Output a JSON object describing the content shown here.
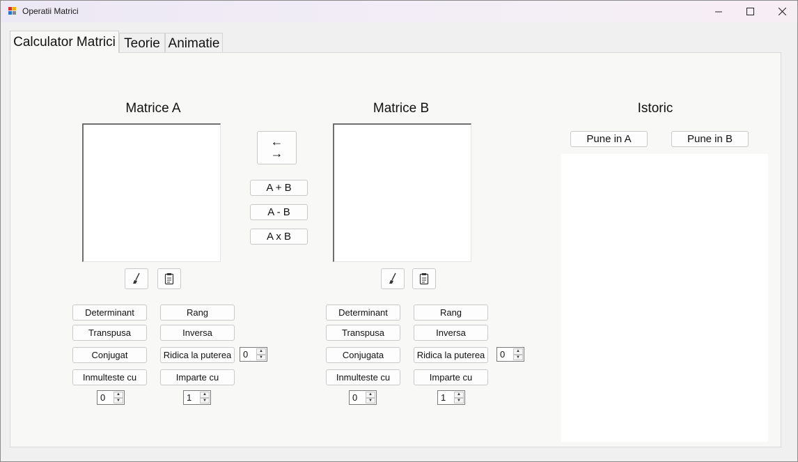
{
  "window": {
    "title": "Operatii Matrici",
    "controls": {
      "minimize": "minimize-icon",
      "maximize": "maximize-icon",
      "close": "close-icon"
    }
  },
  "tabs": [
    {
      "label": "Calculator Matrici",
      "active": true
    },
    {
      "label": "Teorie",
      "active": false
    },
    {
      "label": "Animatie",
      "active": false
    }
  ],
  "matrix_a": {
    "title": "Matrice A",
    "clear_icon": "brush-icon",
    "paste_icon": "clipboard-icon",
    "buttons": {
      "determinant": "Determinant",
      "rang": "Rang",
      "transpusa": "Transpusa",
      "inversa": "Inversa",
      "conjugat": "Conjugat",
      "ridica": "Ridica la puterea",
      "inmulteste": "Inmulteste cu",
      "imparte": "Imparte cu"
    },
    "power_value": "0",
    "multiply_value": "0",
    "divide_value": "1"
  },
  "matrix_b": {
    "title": "Matrice B",
    "clear_icon": "brush-icon",
    "paste_icon": "clipboard-icon",
    "buttons": {
      "determinant": "Determinant",
      "rang": "Rang",
      "transpusa": "Transpusa",
      "inversa": "Inversa",
      "conjugat": "Conjugata",
      "ridica": "Ridica la puterea",
      "inmulteste": "Inmulteste cu",
      "imparte": "Imparte cu"
    },
    "power_value": "0",
    "multiply_value": "0",
    "divide_value": "1"
  },
  "operations": {
    "swap_top": "←",
    "swap_bottom": "→",
    "add": "A + B",
    "subtract": "A - B",
    "multiply": "A x B"
  },
  "history": {
    "title": "Istoric",
    "put_in_a": "Pune in A",
    "put_in_b": "Pune in B"
  }
}
